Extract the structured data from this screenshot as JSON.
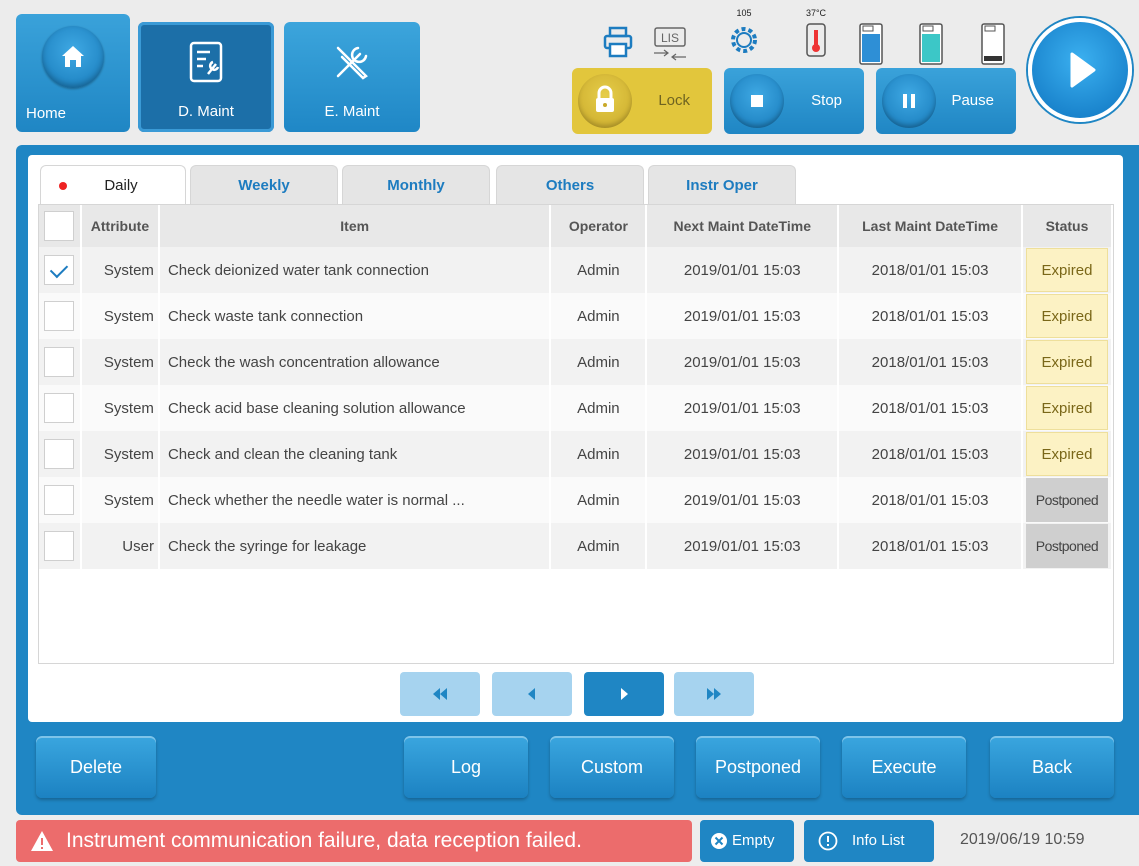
{
  "nav": {
    "home_label": "Home",
    "d_maint_label": "D. Maint",
    "e_maint_label": "E. Maint"
  },
  "status_icons": {
    "lis_label": "LIS",
    "temp1": "105",
    "temp2": "37°C"
  },
  "controls": {
    "lock_label": "Lock",
    "stop_label": "Stop",
    "pause_label": "Pause"
  },
  "tabs": [
    {
      "label": "Daily"
    },
    {
      "label": "Weekly"
    },
    {
      "label": "Monthly"
    },
    {
      "label": "Others"
    },
    {
      "label": "Instr Oper"
    }
  ],
  "table": {
    "headers": [
      "Attribute",
      "Item",
      "Operator",
      "Next Maint DateTime",
      "Last Maint DateTime",
      "Status"
    ],
    "rows": [
      {
        "checked": true,
        "attribute": "System",
        "item": "Check deionized water tank connection",
        "operator": "Admin",
        "next": "2019/01/01 15:03",
        "last": "2018/01/01 15:03",
        "status": "Expired"
      },
      {
        "checked": false,
        "attribute": "System",
        "item": "Check waste tank connection",
        "operator": "Admin",
        "next": "2019/01/01 15:03",
        "last": "2018/01/01 15:03",
        "status": "Expired"
      },
      {
        "checked": false,
        "attribute": "System",
        "item": "Check the wash concentration allowance",
        "operator": "Admin",
        "next": "2019/01/01 15:03",
        "last": "2018/01/01 15:03",
        "status": "Expired"
      },
      {
        "checked": false,
        "attribute": "System",
        "item": "Check acid base cleaning solution allowance",
        "operator": "Admin",
        "next": "2019/01/01 15:03",
        "last": "2018/01/01 15:03",
        "status": "Expired"
      },
      {
        "checked": false,
        "attribute": "System",
        "item": "Check and clean the cleaning tank",
        "operator": "Admin",
        "next": "2019/01/01 15:03",
        "last": "2018/01/01 15:03",
        "status": "Expired"
      },
      {
        "checked": false,
        "attribute": "System",
        "item": "Check whether the needle water is normal ...",
        "operator": "Admin",
        "next": "2019/01/01 15:03",
        "last": "2018/01/01 15:03",
        "status": "Postponed"
      },
      {
        "checked": false,
        "attribute": "User",
        "item": "Check the syringe for leakage",
        "operator": "Admin",
        "next": "2019/01/01 15:03",
        "last": "2018/01/01 15:03",
        "status": "Postponed"
      }
    ]
  },
  "bottom_buttons": {
    "delete": "Delete",
    "log": "Log",
    "custom": "Custom",
    "postponed": "Postponed",
    "execute": "Execute",
    "back": "Back"
  },
  "statusbar": {
    "alert": "Instrument communication failure, data reception failed.",
    "empty": "Empty",
    "info_list": "Info List",
    "datetime": "2019/06/19 10:59"
  },
  "colors": {
    "primary_blue": "#1f86c4",
    "lock_yellow": "#e2c63c",
    "alert_red": "#ec6c6c",
    "expired_bg": "#fcf2c4",
    "postponed_bg": "#cfcfcf"
  }
}
